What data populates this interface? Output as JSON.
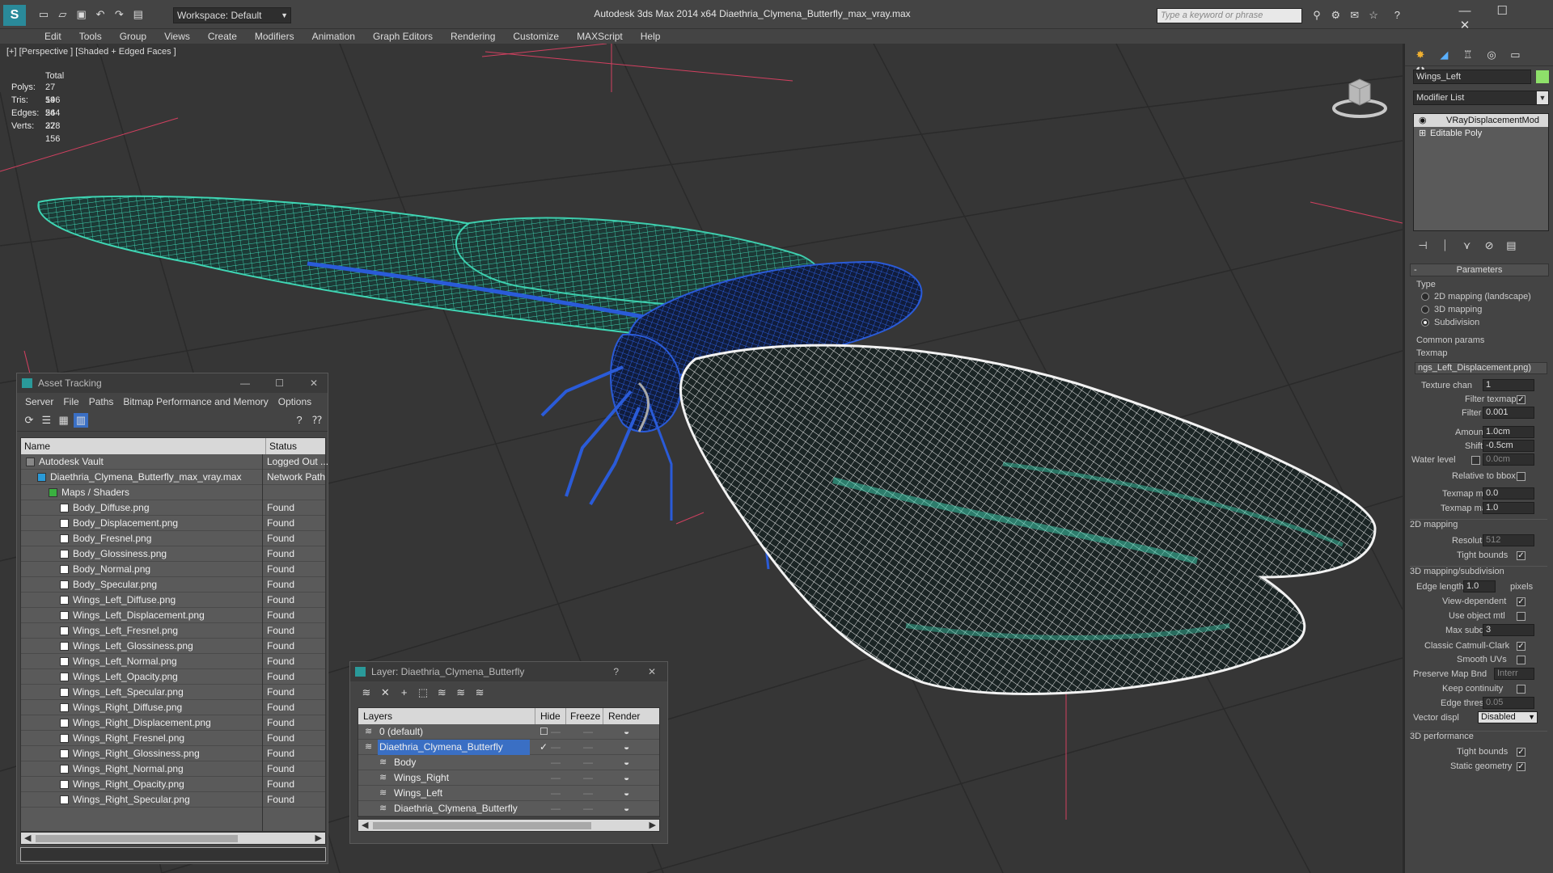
{
  "app": {
    "title": "Autodesk 3ds Max  2014 x64     Diaethria_Clymena_Butterfly_max_vray.max",
    "workspace": "Workspace: Default",
    "search_placeholder": "Type a keyword or phrase"
  },
  "menu": [
    "Edit",
    "Tools",
    "Group",
    "Views",
    "Create",
    "Modifiers",
    "Animation",
    "Graph Editors",
    "Rendering",
    "Customize",
    "MAXScript",
    "Help"
  ],
  "viewport": {
    "label": "[+] [Perspective ] [Shaded + Edged Faces ]",
    "stats": {
      "header": "Total",
      "rows": [
        {
          "label": "Polys:",
          "value": "27 196"
        },
        {
          "label": "Tris:",
          "value": "54 264"
        },
        {
          "label": "Edges:",
          "value": "54 328"
        },
        {
          "label": "Verts:",
          "value": "27 156"
        }
      ]
    }
  },
  "asset_tracking": {
    "title": "Asset Tracking",
    "menu": [
      "Server",
      "File",
      "Paths",
      "Bitmap Performance and Memory",
      "Options"
    ],
    "col_name": "Name",
    "col_status": "Status",
    "rows": [
      {
        "name": "Autodesk Vault",
        "status": "Logged Out ...",
        "indent": 0
      },
      {
        "name": "Diaethria_Clymena_Butterfly_max_vray.max",
        "status": "Network Path",
        "indent": 1
      },
      {
        "name": "Maps / Shaders",
        "status": "",
        "indent": 2
      },
      {
        "name": "Body_Diffuse.png",
        "status": "Found",
        "indent": 3
      },
      {
        "name": "Body_Displacement.png",
        "status": "Found",
        "indent": 3
      },
      {
        "name": "Body_Fresnel.png",
        "status": "Found",
        "indent": 3
      },
      {
        "name": "Body_Glossiness.png",
        "status": "Found",
        "indent": 3
      },
      {
        "name": "Body_Normal.png",
        "status": "Found",
        "indent": 3
      },
      {
        "name": "Body_Specular.png",
        "status": "Found",
        "indent": 3
      },
      {
        "name": "Wings_Left_Diffuse.png",
        "status": "Found",
        "indent": 3
      },
      {
        "name": "Wings_Left_Displacement.png",
        "status": "Found",
        "indent": 3
      },
      {
        "name": "Wings_Left_Fresnel.png",
        "status": "Found",
        "indent": 3
      },
      {
        "name": "Wings_Left_Glossiness.png",
        "status": "Found",
        "indent": 3
      },
      {
        "name": "Wings_Left_Normal.png",
        "status": "Found",
        "indent": 3
      },
      {
        "name": "Wings_Left_Opacity.png",
        "status": "Found",
        "indent": 3
      },
      {
        "name": "Wings_Left_Specular.png",
        "status": "Found",
        "indent": 3
      },
      {
        "name": "Wings_Right_Diffuse.png",
        "status": "Found",
        "indent": 3
      },
      {
        "name": "Wings_Right_Displacement.png",
        "status": "Found",
        "indent": 3
      },
      {
        "name": "Wings_Right_Fresnel.png",
        "status": "Found",
        "indent": 3
      },
      {
        "name": "Wings_Right_Glossiness.png",
        "status": "Found",
        "indent": 3
      },
      {
        "name": "Wings_Right_Normal.png",
        "status": "Found",
        "indent": 3
      },
      {
        "name": "Wings_Right_Opacity.png",
        "status": "Found",
        "indent": 3
      },
      {
        "name": "Wings_Right_Specular.png",
        "status": "Found",
        "indent": 3
      }
    ]
  },
  "layer_dialog": {
    "title": "Layer: Diaethria_Clymena_Butterfly",
    "help": "?",
    "col_layers": "Layers",
    "col_hide": "Hide",
    "col_freeze": "Freeze",
    "col_render": "Render",
    "rows": [
      {
        "name": "0 (default)",
        "indent": 0,
        "selected": false
      },
      {
        "name": "Diaethria_Clymena_Butterfly",
        "indent": 0,
        "selected": true
      },
      {
        "name": "Body",
        "indent": 1,
        "selected": false
      },
      {
        "name": "Wings_Right",
        "indent": 1,
        "selected": false
      },
      {
        "name": "Wings_Left",
        "indent": 1,
        "selected": false
      },
      {
        "name": "Diaethria_Clymena_Butterfly",
        "indent": 1,
        "selected": false
      }
    ]
  },
  "command_panel": {
    "object_name": "Wings_Left",
    "object_color": "#8ee06a",
    "modifier_list": "Modifier List",
    "stack": [
      "VRayDisplacementMod",
      "Editable Poly"
    ],
    "rollout": "Parameters",
    "type_label": "Type",
    "type_options": [
      "2D mapping (landscape)",
      "3D mapping",
      "Subdivision"
    ],
    "common_params": "Common params",
    "texmap_label": "Texmap",
    "texmap_value": "ngs_Left_Displacement.png)",
    "texture_chan_label": "Texture chan",
    "texture_chan": "1",
    "filter_texmap": "Filter texmap",
    "filter_blur_label": "Filter blur",
    "filter_blur": "0.001",
    "amount_label": "Amount",
    "amount": "1.0cm",
    "shift_label": "Shift",
    "shift": "-0.5cm",
    "water_level_label": "Water level",
    "water_level": "0.0cm",
    "relative_bbox": "Relative to bbox",
    "texmap_min_label": "Texmap min",
    "texmap_min": "0.0",
    "texmap_max_label": "Texmap max",
    "texmap_max": "1.0",
    "mapping_2d": "2D mapping",
    "resolution_label": "Resolution",
    "resolution": "512",
    "tight_bounds": "Tight bounds",
    "mapping_3d": "3D mapping/subdivision",
    "edge_length_label": "Edge length",
    "edge_length": "1.0",
    "pixels": "pixels",
    "view_dependent": "View-dependent",
    "use_object_mtl": "Use object mtl",
    "max_subdivs_label": "Max subdivs",
    "max_subdivs": "3",
    "classic_catmull": "Classic Catmull-Clark",
    "smooth_uvs": "Smooth UVs",
    "preserve_map_label": "Preserve Map Bnd",
    "preserve_map": "Interr",
    "keep_continuity": "Keep continuity",
    "edge_thresh_label": "Edge thresh",
    "edge_thresh": "0.05",
    "vector_displ_label": "Vector displ",
    "vector_displ": "Disabled",
    "perf_3d": "3D performance",
    "tight_bounds2": "Tight bounds",
    "static_geometry": "Static geometry"
  },
  "colors": {
    "wire_teal": "#3fd6b4",
    "wire_blue": "#2a5bd8",
    "wire_white": "#f2f2f2",
    "selection": "#3a6fc4"
  }
}
